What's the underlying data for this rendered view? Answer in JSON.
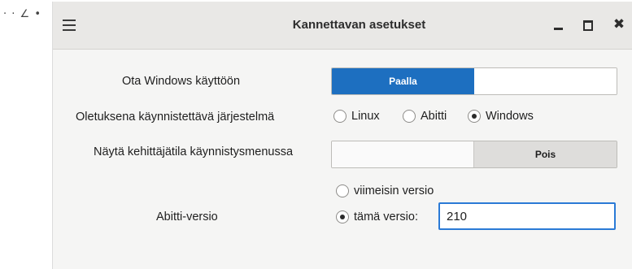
{
  "desktop": {
    "marks": "· · ∠ •"
  },
  "window": {
    "title": "Kannettavan asetukset",
    "close_glyph": "✖"
  },
  "settings": {
    "windows": {
      "label": "Ota Windows käyttöön",
      "on_label": "Paalla",
      "off_label": "",
      "state": "on"
    },
    "default_os": {
      "label": "Oletuksena käynnistettävä järjestelmä",
      "options": [
        "Linux",
        "Abitti",
        "Windows"
      ],
      "selected": "Windows"
    },
    "dev_mode": {
      "label": "Näytä kehittäjätila käynnistysmenussa",
      "on_label": "",
      "off_label": "Pois",
      "state": "off"
    },
    "abitti_version": {
      "label": "Abitti-versio",
      "latest_label": "viimeisin versio",
      "this_label": "tämä versio:",
      "selected": "this",
      "value": "210"
    }
  }
}
